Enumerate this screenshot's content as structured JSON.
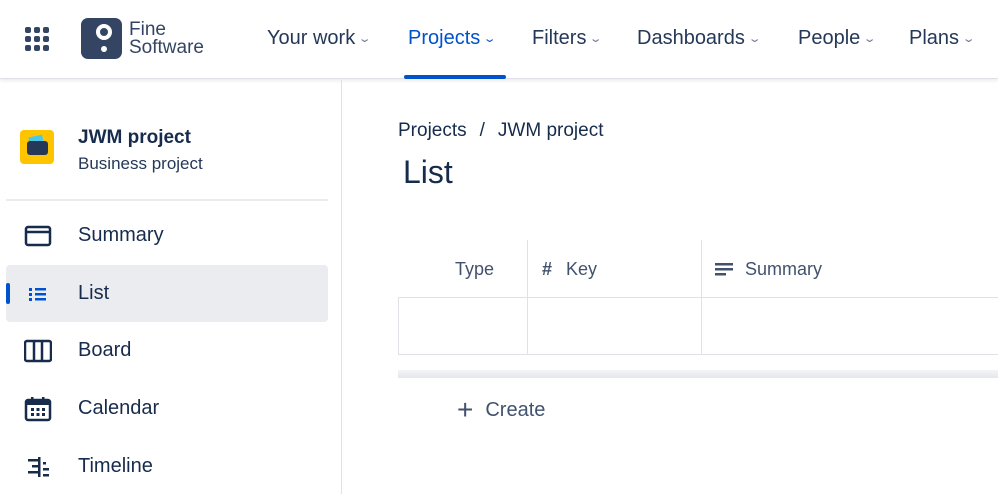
{
  "header": {
    "logo_text_line1": "Fine",
    "logo_text_line2": "Software",
    "nav": [
      "Your work",
      "Projects",
      "Filters",
      "Dashboards",
      "People",
      "Plans"
    ],
    "active_nav": "Projects"
  },
  "sidebar": {
    "project_name": "JWM project",
    "project_type": "Business project",
    "items": [
      {
        "label": "Summary",
        "icon": "summary-icon"
      },
      {
        "label": "List",
        "icon": "list-icon"
      },
      {
        "label": "Board",
        "icon": "board-icon"
      },
      {
        "label": "Calendar",
        "icon": "calendar-icon"
      },
      {
        "label": "Timeline",
        "icon": "timeline-icon"
      }
    ],
    "active_item": "List",
    "accent": "#0052cc"
  },
  "main": {
    "breadcrumb": [
      "Projects",
      "/",
      "JWM project"
    ],
    "title": "List",
    "columns": [
      "Type",
      "Key",
      "Summary"
    ],
    "create_label": "Create"
  }
}
